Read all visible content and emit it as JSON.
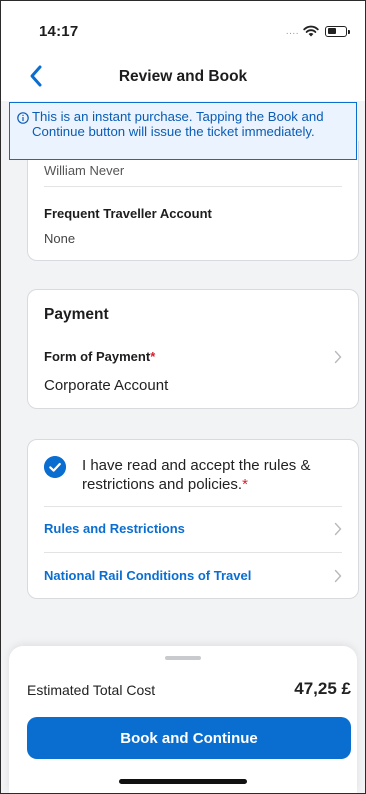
{
  "status_bar": {
    "time": "14:17",
    "signal_dots": "....",
    "wifi_icon": "wifi-icon",
    "battery_icon": "battery-icon"
  },
  "navbar": {
    "title": "Review and Book",
    "back_icon": "chevron-left-icon"
  },
  "banner": {
    "icon": "info-icon",
    "text": "This is an instant purchase. Tapping the Book and Continue button will issue the ticket immediately."
  },
  "traveller_card": {
    "name_partial": "William Never",
    "frequent_traveller_label": "Frequent Traveller Account",
    "frequent_traveller_value": "None"
  },
  "payment_card": {
    "title": "Payment",
    "form_of_payment_label": "Form of Payment",
    "required_mark": "*",
    "form_of_payment_value": "Corporate Account"
  },
  "policy_card": {
    "accept_text": "I have read and accept the rules & restrictions and policies.",
    "required_mark": "*",
    "accepted": true,
    "links": [
      {
        "label": "Rules and Restrictions"
      },
      {
        "label": "National Rail Conditions of Travel"
      }
    ]
  },
  "footer": {
    "estimated_total_label": "Estimated Total Cost",
    "estimated_total_value": "47,25 £",
    "book_button_label": "Book and Continue"
  },
  "colors": {
    "accent": "#0a6ed1",
    "banner_bg": "#eaf3fe",
    "required": "#d32030",
    "background": "#f2f3f5"
  }
}
